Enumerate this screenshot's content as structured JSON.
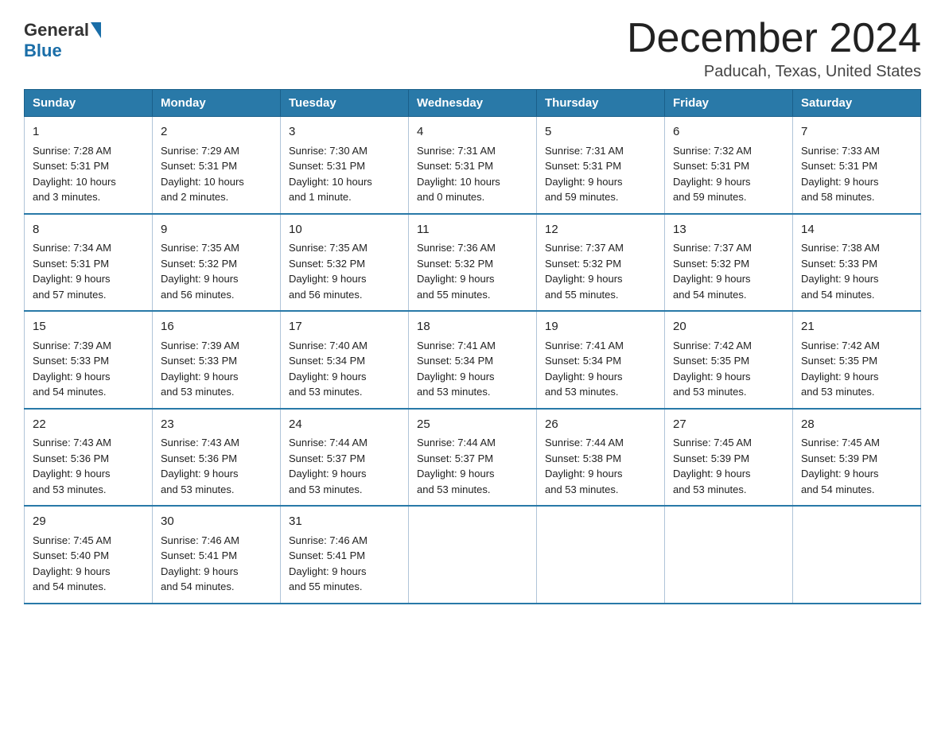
{
  "logo": {
    "general": "General",
    "blue": "Blue"
  },
  "header": {
    "month": "December 2024",
    "location": "Paducah, Texas, United States"
  },
  "days_of_week": [
    "Sunday",
    "Monday",
    "Tuesday",
    "Wednesday",
    "Thursday",
    "Friday",
    "Saturday"
  ],
  "weeks": [
    [
      {
        "day": "1",
        "sunrise": "7:28 AM",
        "sunset": "5:31 PM",
        "daylight": "10 hours and 3 minutes."
      },
      {
        "day": "2",
        "sunrise": "7:29 AM",
        "sunset": "5:31 PM",
        "daylight": "10 hours and 2 minutes."
      },
      {
        "day": "3",
        "sunrise": "7:30 AM",
        "sunset": "5:31 PM",
        "daylight": "10 hours and 1 minute."
      },
      {
        "day": "4",
        "sunrise": "7:31 AM",
        "sunset": "5:31 PM",
        "daylight": "10 hours and 0 minutes."
      },
      {
        "day": "5",
        "sunrise": "7:31 AM",
        "sunset": "5:31 PM",
        "daylight": "9 hours and 59 minutes."
      },
      {
        "day": "6",
        "sunrise": "7:32 AM",
        "sunset": "5:31 PM",
        "daylight": "9 hours and 59 minutes."
      },
      {
        "day": "7",
        "sunrise": "7:33 AM",
        "sunset": "5:31 PM",
        "daylight": "9 hours and 58 minutes."
      }
    ],
    [
      {
        "day": "8",
        "sunrise": "7:34 AM",
        "sunset": "5:31 PM",
        "daylight": "9 hours and 57 minutes."
      },
      {
        "day": "9",
        "sunrise": "7:35 AM",
        "sunset": "5:32 PM",
        "daylight": "9 hours and 56 minutes."
      },
      {
        "day": "10",
        "sunrise": "7:35 AM",
        "sunset": "5:32 PM",
        "daylight": "9 hours and 56 minutes."
      },
      {
        "day": "11",
        "sunrise": "7:36 AM",
        "sunset": "5:32 PM",
        "daylight": "9 hours and 55 minutes."
      },
      {
        "day": "12",
        "sunrise": "7:37 AM",
        "sunset": "5:32 PM",
        "daylight": "9 hours and 55 minutes."
      },
      {
        "day": "13",
        "sunrise": "7:37 AM",
        "sunset": "5:32 PM",
        "daylight": "9 hours and 54 minutes."
      },
      {
        "day": "14",
        "sunrise": "7:38 AM",
        "sunset": "5:33 PM",
        "daylight": "9 hours and 54 minutes."
      }
    ],
    [
      {
        "day": "15",
        "sunrise": "7:39 AM",
        "sunset": "5:33 PM",
        "daylight": "9 hours and 54 minutes."
      },
      {
        "day": "16",
        "sunrise": "7:39 AM",
        "sunset": "5:33 PM",
        "daylight": "9 hours and 53 minutes."
      },
      {
        "day": "17",
        "sunrise": "7:40 AM",
        "sunset": "5:34 PM",
        "daylight": "9 hours and 53 minutes."
      },
      {
        "day": "18",
        "sunrise": "7:41 AM",
        "sunset": "5:34 PM",
        "daylight": "9 hours and 53 minutes."
      },
      {
        "day": "19",
        "sunrise": "7:41 AM",
        "sunset": "5:34 PM",
        "daylight": "9 hours and 53 minutes."
      },
      {
        "day": "20",
        "sunrise": "7:42 AM",
        "sunset": "5:35 PM",
        "daylight": "9 hours and 53 minutes."
      },
      {
        "day": "21",
        "sunrise": "7:42 AM",
        "sunset": "5:35 PM",
        "daylight": "9 hours and 53 minutes."
      }
    ],
    [
      {
        "day": "22",
        "sunrise": "7:43 AM",
        "sunset": "5:36 PM",
        "daylight": "9 hours and 53 minutes."
      },
      {
        "day": "23",
        "sunrise": "7:43 AM",
        "sunset": "5:36 PM",
        "daylight": "9 hours and 53 minutes."
      },
      {
        "day": "24",
        "sunrise": "7:44 AM",
        "sunset": "5:37 PM",
        "daylight": "9 hours and 53 minutes."
      },
      {
        "day": "25",
        "sunrise": "7:44 AM",
        "sunset": "5:37 PM",
        "daylight": "9 hours and 53 minutes."
      },
      {
        "day": "26",
        "sunrise": "7:44 AM",
        "sunset": "5:38 PM",
        "daylight": "9 hours and 53 minutes."
      },
      {
        "day": "27",
        "sunrise": "7:45 AM",
        "sunset": "5:39 PM",
        "daylight": "9 hours and 53 minutes."
      },
      {
        "day": "28",
        "sunrise": "7:45 AM",
        "sunset": "5:39 PM",
        "daylight": "9 hours and 54 minutes."
      }
    ],
    [
      {
        "day": "29",
        "sunrise": "7:45 AM",
        "sunset": "5:40 PM",
        "daylight": "9 hours and 54 minutes."
      },
      {
        "day": "30",
        "sunrise": "7:46 AM",
        "sunset": "5:41 PM",
        "daylight": "9 hours and 54 minutes."
      },
      {
        "day": "31",
        "sunrise": "7:46 AM",
        "sunset": "5:41 PM",
        "daylight": "9 hours and 55 minutes."
      },
      null,
      null,
      null,
      null
    ]
  ],
  "labels": {
    "sunrise": "Sunrise:",
    "sunset": "Sunset:",
    "daylight": "Daylight:"
  }
}
